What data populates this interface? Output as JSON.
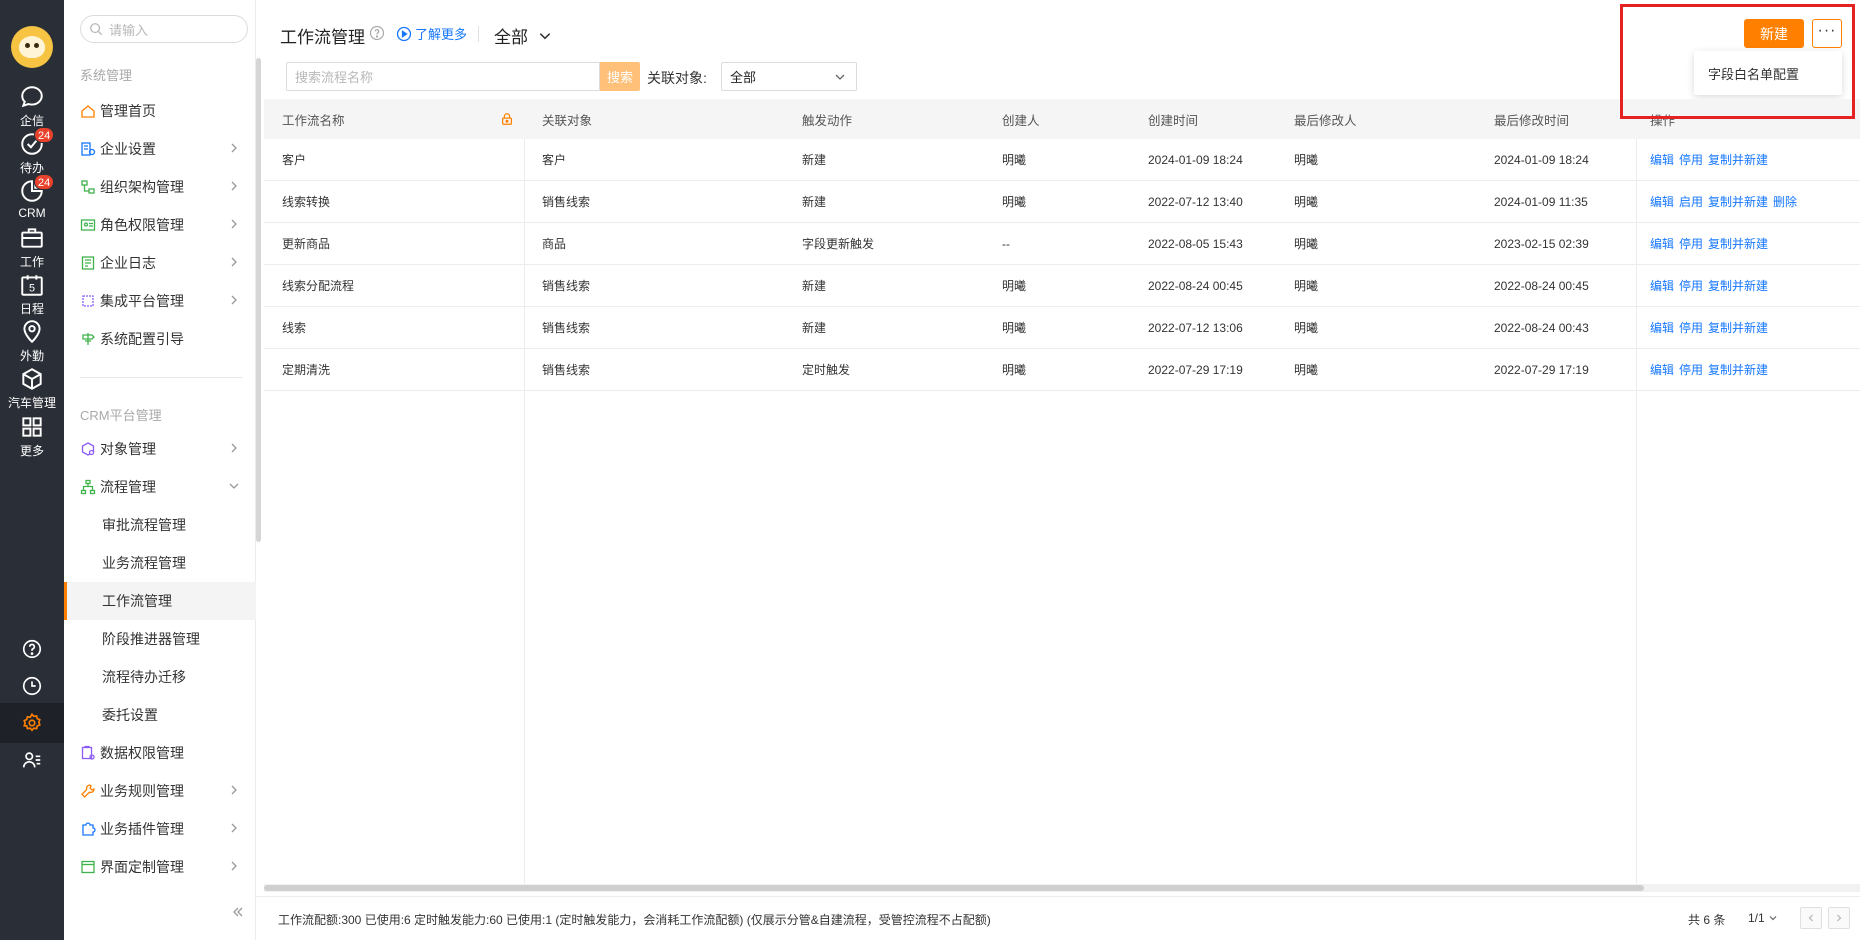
{
  "rail": {
    "items": [
      {
        "label": "企信",
        "icon": "chat-icon"
      },
      {
        "label": "待办",
        "icon": "todo-check-icon",
        "badge": "24"
      },
      {
        "label": "CRM",
        "icon": "crm-pie-icon",
        "badge": "24"
      },
      {
        "label": "工作",
        "icon": "briefcase-icon"
      },
      {
        "label": "日程",
        "icon": "calendar-icon",
        "day": "5"
      },
      {
        "label": "外勤",
        "icon": "location-pin-icon"
      },
      {
        "label": "汽车管理",
        "icon": "cube-icon"
      },
      {
        "label": "更多",
        "icon": "grid-icon"
      }
    ]
  },
  "sidebar": {
    "search_placeholder": "请输入",
    "section1": "系统管理",
    "items1": [
      {
        "label": "管理首页"
      },
      {
        "label": "企业设置"
      },
      {
        "label": "组织架构管理"
      },
      {
        "label": "角色权限管理"
      },
      {
        "label": "企业日志"
      },
      {
        "label": "集成平台管理"
      },
      {
        "label": "系统配置引导"
      }
    ],
    "section2": "CRM平台管理",
    "items2": [
      {
        "label": "对象管理"
      },
      {
        "label": "流程管理"
      }
    ],
    "sub_items": [
      {
        "label": "审批流程管理"
      },
      {
        "label": "业务流程管理"
      },
      {
        "label": "工作流管理"
      },
      {
        "label": "阶段推进器管理"
      },
      {
        "label": "流程待办迁移"
      },
      {
        "label": "委托设置"
      }
    ],
    "items3": [
      {
        "label": "数据权限管理"
      },
      {
        "label": "业务规则管理"
      },
      {
        "label": "业务插件管理"
      },
      {
        "label": "界面定制管理"
      }
    ]
  },
  "header": {
    "title": "工作流管理",
    "learn_more": "了解更多",
    "scope": "全部",
    "new_button": "新建",
    "more_button": "···",
    "dropdown_item": "字段白名单配置"
  },
  "filters": {
    "search_placeholder": "搜索流程名称",
    "search_button": "搜索",
    "related_label": "关联对象:",
    "related_value": "全部"
  },
  "table": {
    "columns": [
      "工作流名称",
      "关联对象",
      "触发动作",
      "创建人",
      "创建时间",
      "最后修改人",
      "最后修改时间",
      "操作"
    ],
    "rows": [
      {
        "name": "客户",
        "object": "客户",
        "trigger": "新建",
        "creator": "明曦",
        "created": "2024-01-09 18:24",
        "modifier": "明曦",
        "modified": "2024-01-09 18:24",
        "ops": [
          "编辑",
          "停用",
          "复制并新建",
          ""
        ]
      },
      {
        "name": "线索转换",
        "object": "销售线索",
        "trigger": "新建",
        "creator": "明曦",
        "created": "2022-07-12 13:40",
        "modifier": "明曦",
        "modified": "2024-01-09 11:35",
        "ops": [
          "编辑",
          "启用",
          "复制并新建",
          "删除"
        ]
      },
      {
        "name": "更新商品",
        "object": "商品",
        "trigger": "字段更新触发",
        "creator": "--",
        "created": "2022-08-05 15:43",
        "modifier": "明曦",
        "modified": "2023-02-15 02:39",
        "ops": [
          "编辑",
          "停用",
          "复制并新建",
          ""
        ]
      },
      {
        "name": "线索分配流程",
        "object": "销售线索",
        "trigger": "新建",
        "creator": "明曦",
        "created": "2022-08-24 00:45",
        "modifier": "明曦",
        "modified": "2022-08-24 00:45",
        "ops": [
          "编辑",
          "停用",
          "复制并新建",
          ""
        ]
      },
      {
        "name": "线索",
        "object": "销售线索",
        "trigger": "新建",
        "creator": "明曦",
        "created": "2022-07-12 13:06",
        "modifier": "明曦",
        "modified": "2022-08-24 00:43",
        "ops": [
          "编辑",
          "停用",
          "复制并新建",
          ""
        ]
      },
      {
        "name": "定期清洗",
        "object": "销售线索",
        "trigger": "定时触发",
        "creator": "明曦",
        "created": "2022-07-29 17:19",
        "modifier": "明曦",
        "modified": "2022-07-29 17:19",
        "ops": [
          "编辑",
          "停用",
          "复制并新建",
          ""
        ]
      }
    ]
  },
  "footer": {
    "quota_text": "工作流配额:300  已使用:6  定时触发能力:60  已使用:1  (定时触发能力，会消耗工作流配额)   (仅展示分管&自建流程，受管控流程不占配额)",
    "total": "共 6 条",
    "page": "1/1"
  },
  "colors": {
    "accent": "#ff8000",
    "link": "#1677ff",
    "rail": "#2a2e36",
    "highlight": "#e52222"
  }
}
